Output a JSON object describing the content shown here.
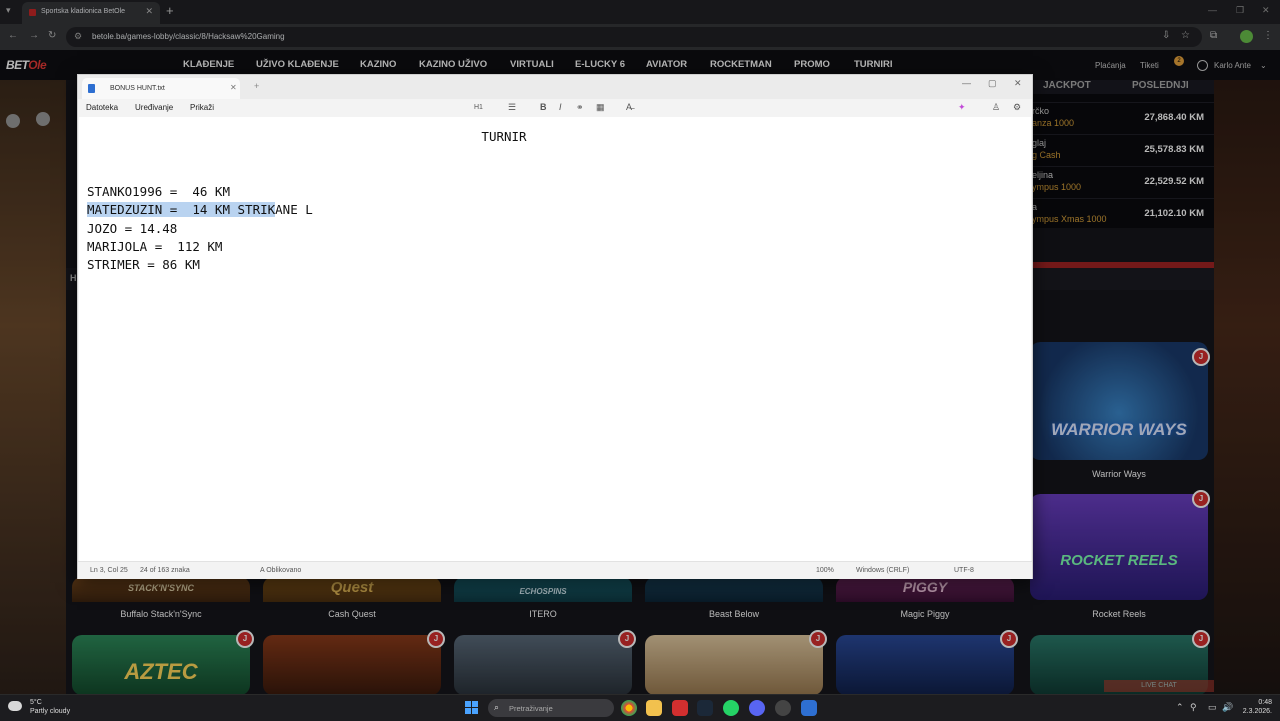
{
  "browser": {
    "tab_title": "Sportska kladionica BetOle",
    "url": "betole.ba/games-lobby/classic/8/Hacksaw%20Gaming",
    "new_tab": "+",
    "close": "✕"
  },
  "site": {
    "logo_main": "BET",
    "logo_accent": "Ole",
    "nav": [
      "KLAĐENJE",
      "UŽIVO KLAĐENJE",
      "KAZINO",
      "KAZINO UŽIVO",
      "VIRTUALI",
      "E-LUCKY 6",
      "AVIATOR",
      "ROCKETMAN",
      "PROMO",
      "TURNIRI"
    ],
    "placanja": "Plaćanja",
    "tiketi": "Tiketi",
    "tiketi_badge": "2",
    "username": "Karlo Ante"
  },
  "jackpot": {
    "tabs": [
      "JACKPOT",
      "POSLEDNJI"
    ],
    "rows": [
      {
        "name": "rčko",
        "game": "anza 1000",
        "amount": "27,868.40 KM"
      },
      {
        "name": "glaj",
        "game": "g Cash",
        "amount": "25,578.83 KM"
      },
      {
        "name": "eljina",
        "game": "ympus 1000",
        "amount": "22,529.52 KM"
      },
      {
        "name": "a",
        "game": "ympus Xmas 1000",
        "amount": "21,102.10 KM"
      }
    ]
  },
  "games": {
    "section_label": "H",
    "row1": [
      "Warrior Ways"
    ],
    "row2": [
      "Buffalo Stack'n'Sync",
      "Cash Quest",
      "ITERO",
      "Beast Below",
      "Magic Piggy",
      "Rocket Reels"
    ],
    "logos": {
      "warrior": "WARRIOR WAYS",
      "rocket": "ROCKET REELS",
      "aztec": "AZTEC",
      "buffalo": "STACK'N'SYNC",
      "quest": "Quest",
      "itero": "ECHOSPINS",
      "piggy": "PIGGY"
    },
    "chip": "J",
    "live_chat": "LIVE CHAT"
  },
  "notepad": {
    "file_tab": "BONUS HUNT.txt",
    "plus": "+",
    "menus": [
      "Datoteka",
      "Uređivanje",
      "Prikaži"
    ],
    "toolbar": {
      "heading": "H1",
      "bold": "B",
      "italic": "I"
    },
    "lines": {
      "title": "TURNIR",
      "l1": "STANKO1996 =  46 KM",
      "l2_selected": "MATEDZUZIN =  14 KM STRIK",
      "l2_rest": "ANE L",
      "l3": "JOZO = 14.48",
      "l4": "MARIJOLA =  112 KM",
      "l5": "STRIMER = 86 KM"
    },
    "status": {
      "position": "Ln 3, Col 25",
      "chars": "24 of 163 znaka",
      "format": "Oblikovano",
      "zoom": "100%",
      "eol": "Windows (CRLF)",
      "encoding": "UTF-8"
    }
  },
  "taskbar": {
    "temp": "5°C",
    "weather": "Partly cloudy",
    "search_placeholder": "Pretraživanje",
    "time": "0:48",
    "date": "2.3.2026."
  }
}
